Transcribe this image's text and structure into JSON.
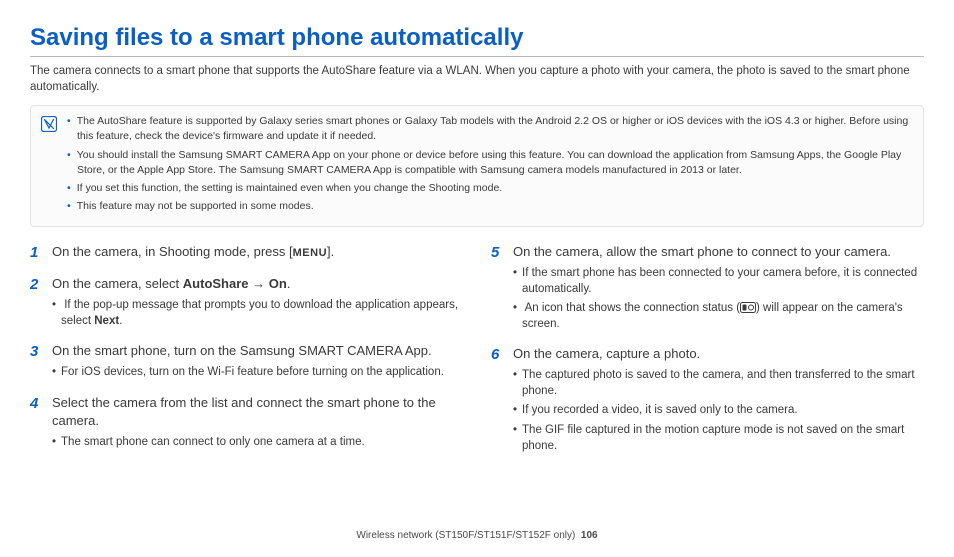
{
  "title": "Saving files to a smart phone automatically",
  "intro": "The camera connects to a smart phone that supports the AutoShare feature via a WLAN. When you capture a photo with your camera, the photo is saved to the smart phone automatically.",
  "notes": [
    "The AutoShare feature is supported by Galaxy series smart phones or Galaxy Tab models with the Android 2.2 OS or higher or iOS devices with the iOS 4.3 or higher. Before using this feature, check the device's firmware and update it if needed.",
    "You should install the Samsung SMART CAMERA App on your phone or device before using this feature. You can download the application from Samsung Apps, the Google Play Store, or the Apple App Store. The Samsung SMART CAMERA App is compatible with Samsung camera models manufactured in 2013 or later.",
    "If you set this function, the setting is maintained even when you change the Shooting mode.",
    "This feature may not be supported in some modes."
  ],
  "steps": {
    "s1": {
      "num": "1",
      "pre": "On the camera, in Shooting mode, press [",
      "menu": "MENU",
      "post": "]."
    },
    "s2": {
      "num": "2",
      "pre": "On the camera, select ",
      "b1": "AutoShare",
      "arrow": " → ",
      "b2": "On",
      "post": ".",
      "sub_pre": "If the pop-up message that prompts you to download the application appears, select ",
      "sub_b": "Next",
      "sub_post": "."
    },
    "s3": {
      "num": "3",
      "text": "On the smart phone, turn on the Samsung SMART CAMERA App.",
      "sub": "For iOS devices, turn on the Wi-Fi feature before turning on the application."
    },
    "s4": {
      "num": "4",
      "text": "Select the camera from the list and connect the smart phone to the camera.",
      "sub": "The smart phone can connect to only one camera at a time."
    },
    "s5": {
      "num": "5",
      "text": "On the camera, allow the smart phone to connect to your camera.",
      "sub1": "If the smart phone has been connected to your camera before, it is connected automatically.",
      "sub2_pre": "An icon that shows the connection status (",
      "sub2_post": ") will appear on the camera's screen."
    },
    "s6": {
      "num": "6",
      "text": "On the camera, capture a photo.",
      "sub1": "The captured photo is saved to the camera, and then transferred to the smart phone.",
      "sub2": "If you recorded a video, it is saved only to the camera.",
      "sub3": "The GIF file captured in the motion capture mode is not saved on the smart phone."
    }
  },
  "footer": {
    "section": "Wireless network  (ST150F/ST151F/ST152F only)",
    "page": "106"
  }
}
